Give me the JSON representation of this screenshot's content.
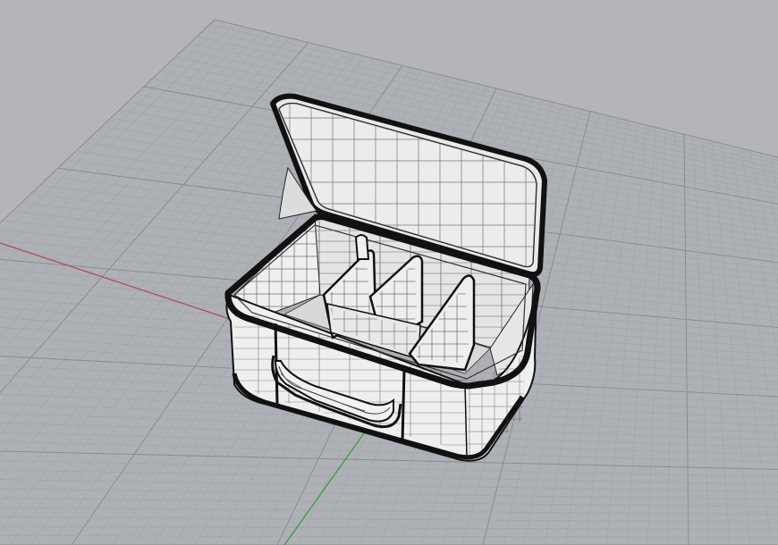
{
  "viewport": {
    "projection": "perspective",
    "display_mode": "shaded-wireframe",
    "grid_visible": true,
    "world_axes_visible": true,
    "colors": {
      "background": "#b3b5b9",
      "grid_minor": "#a3a5aa",
      "grid_major": "#8a8c92",
      "x_axis": "#b04a4a",
      "y_axis": "#3f9f4a",
      "model_surface": "#eeeeee",
      "model_shadow": "#cfcfcf",
      "model_edge": "#111111"
    }
  },
  "model": {
    "object": "open-storage-case",
    "parts": [
      "lid",
      "base",
      "divider",
      "divider",
      "divider",
      "front-handle"
    ]
  }
}
